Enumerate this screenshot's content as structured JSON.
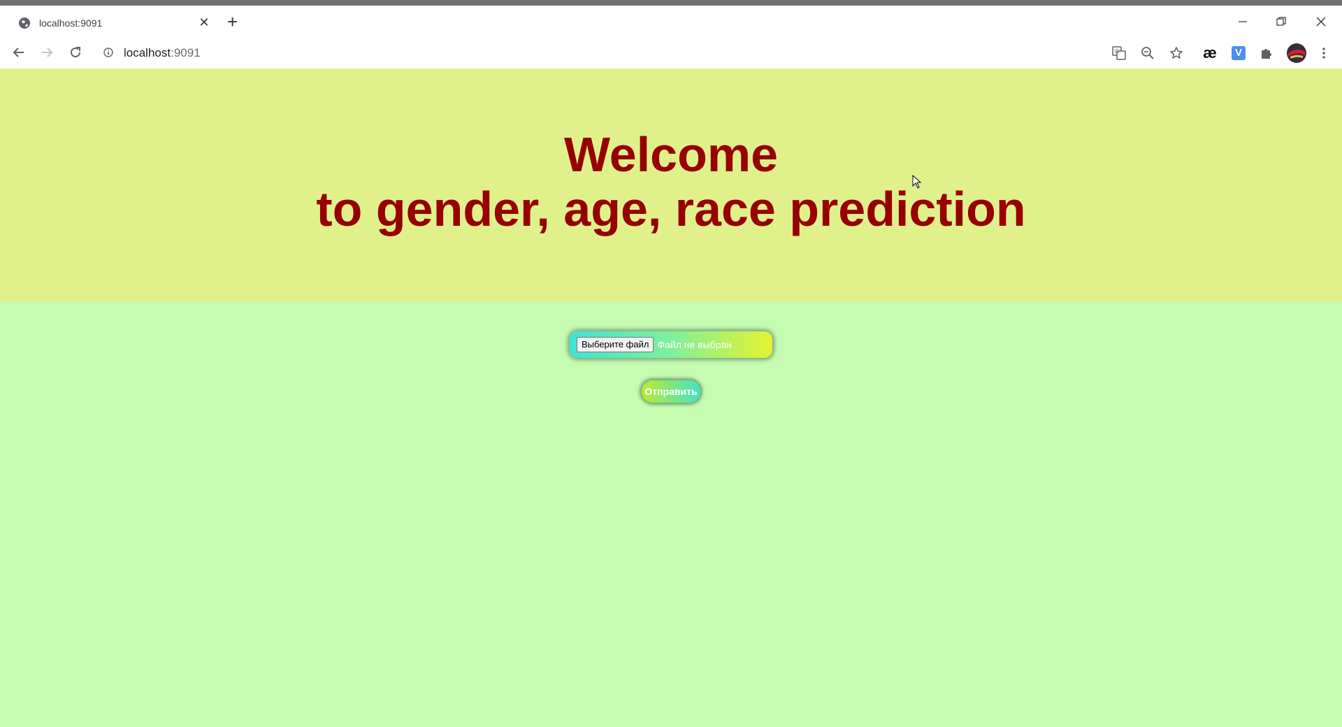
{
  "browser": {
    "tab_title": "localhost:9091",
    "new_tab_symbol": "+",
    "url_host": "localhost",
    "url_port": ":9091",
    "toolbar_icons": [
      "translate-icon",
      "zoom-icon",
      "bookmark-star-icon",
      "ae-extension-icon",
      "v-extension-icon",
      "extensions-puzzle-icon",
      "profile-avatar",
      "menu-kebab-icon"
    ],
    "ae_label": "æ",
    "v_label": "V",
    "v_color": "#4e8df5"
  },
  "page": {
    "title_line1": "Welcome",
    "title_line2": "to gender, age, race prediction",
    "file_button_label": "Выберите файл",
    "file_status": "Файл не выбран",
    "submit_label": "Отправить"
  },
  "colors": {
    "hero_bg": "#e0f18c",
    "content_bg": "#c6fcb1",
    "title_color": "#970000"
  }
}
